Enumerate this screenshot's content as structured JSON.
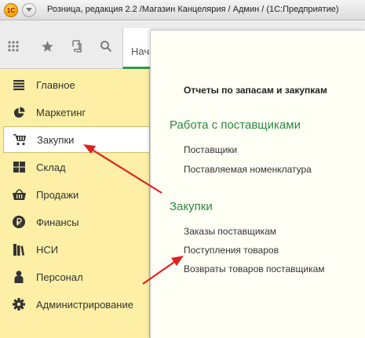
{
  "window": {
    "logo_text": "1С",
    "title": "Розница, редакция 2.2 /Магазин Канцелярия / Админ /  (1С:Предприятие)"
  },
  "toolbar": {
    "icons": [
      "apps-grid-icon",
      "star-icon",
      "history-icon",
      "search-icon"
    ],
    "home_tab_label": "Начальная страница"
  },
  "sidebar": {
    "items": [
      {
        "label": "Главное",
        "icon": "menu-list-icon"
      },
      {
        "label": "Маркетинг",
        "icon": "pie-chart-icon"
      },
      {
        "label": "Закупки",
        "icon": "shopping-cart-icon",
        "active": true
      },
      {
        "label": "Склад",
        "icon": "warehouse-grid-icon"
      },
      {
        "label": "Продажи",
        "icon": "basket-icon"
      },
      {
        "label": "Финансы",
        "icon": "ruble-icon"
      },
      {
        "label": "НСИ",
        "icon": "books-icon"
      },
      {
        "label": "Персонал",
        "icon": "person-icon"
      },
      {
        "label": "Администрирование",
        "icon": "gear-icon"
      }
    ]
  },
  "panel": {
    "heading": "Отчеты по запасам и закупкам",
    "sections": [
      {
        "title": "Работа с поставщиками",
        "links": [
          "Поставщики",
          "Поставляемая номенклатура"
        ]
      },
      {
        "title": "Закупки",
        "links": [
          "Заказы поставщикам",
          "Поступления товаров",
          "Возвраты товаров поставщикам"
        ]
      }
    ]
  },
  "colors": {
    "sidebar_bg": "#fdf0a6",
    "section_title": "#2b8a3e",
    "annotation_arrow": "#e02020"
  }
}
